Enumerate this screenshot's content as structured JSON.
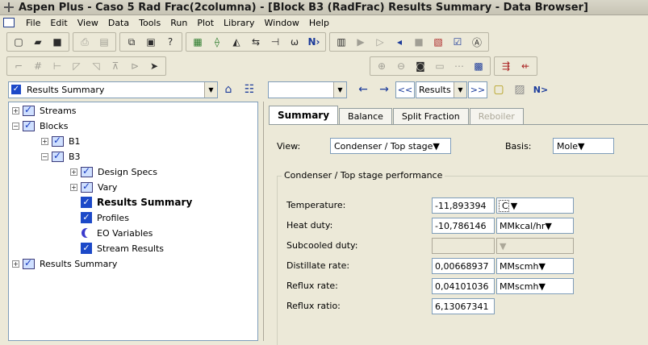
{
  "window": {
    "title": "Aspen Plus - Caso 5 Rad Frac(2columna) - [Block B3 (RadFrac) Results Summary - Data Browser]"
  },
  "menu": [
    "File",
    "Edit",
    "View",
    "Data",
    "Tools",
    "Run",
    "Plot",
    "Library",
    "Window",
    "Help"
  ],
  "navbar": {
    "form_selector": "Results Summary",
    "empty_combo": "",
    "nav_combo": "Results",
    "back_icon": "←",
    "forward_icon": "→",
    "prev_icon": "<<",
    "next_icon": ">>",
    "next_input_icon": "N>"
  },
  "tree": [
    {
      "label": "Streams",
      "expander": "+",
      "icon": "folder-check",
      "level": 0,
      "bold": false
    },
    {
      "label": "Blocks",
      "expander": "−",
      "icon": "folder-check",
      "level": 0,
      "bold": false
    },
    {
      "label": "B1",
      "expander": "+",
      "icon": "folder-check",
      "level": 1,
      "bold": false
    },
    {
      "label": "B3",
      "expander": "−",
      "icon": "folder-check",
      "level": 1,
      "bold": false
    },
    {
      "label": "Design Specs",
      "expander": "+",
      "icon": "folder-check",
      "level": 2,
      "bold": false
    },
    {
      "label": "Vary",
      "expander": "+",
      "icon": "folder-check",
      "level": 2,
      "bold": false
    },
    {
      "label": "Results Summary",
      "expander": "",
      "icon": "check",
      "level": 2,
      "bold": true
    },
    {
      "label": "Profiles",
      "expander": "",
      "icon": "check",
      "level": 2,
      "bold": false
    },
    {
      "label": "EO Variables",
      "expander": "",
      "icon": "eo",
      "level": 2,
      "bold": false
    },
    {
      "label": "Stream Results",
      "expander": "",
      "icon": "check",
      "level": 2,
      "bold": false
    },
    {
      "label": "Results Summary",
      "expander": "+",
      "icon": "folder-check",
      "level": 0,
      "bold": false
    }
  ],
  "tabs": [
    {
      "label": "Summary",
      "state": "active"
    },
    {
      "label": "Balance",
      "state": "normal"
    },
    {
      "label": "Split Fraction",
      "state": "normal"
    },
    {
      "label": "Reboiler",
      "state": "disabled"
    }
  ],
  "form": {
    "view_label": "View:",
    "view_value": "Condenser / Top stage",
    "basis_label": "Basis:",
    "basis_value": "Mole",
    "group_title": "Condenser / Top stage performance",
    "rows": [
      {
        "label": "Temperature:",
        "value": "-11,893394",
        "unit": "C",
        "has_unit": true,
        "disabled": false
      },
      {
        "label": "Heat duty:",
        "value": "-10,786146",
        "unit": "MMkcal/hr",
        "has_unit": true,
        "disabled": false
      },
      {
        "label": "Subcooled duty:",
        "value": "",
        "unit": "",
        "has_unit": true,
        "disabled": true
      },
      {
        "label": "Distillate rate:",
        "value": "0,00668937",
        "unit": "MMscmh",
        "has_unit": true,
        "disabled": false
      },
      {
        "label": "Reflux rate:",
        "value": "0,04101036",
        "unit": "MMscmh",
        "has_unit": true,
        "disabled": false
      },
      {
        "label": "Reflux ratio:",
        "value": "6,13067341",
        "unit": "",
        "has_unit": false,
        "disabled": false
      }
    ]
  }
}
